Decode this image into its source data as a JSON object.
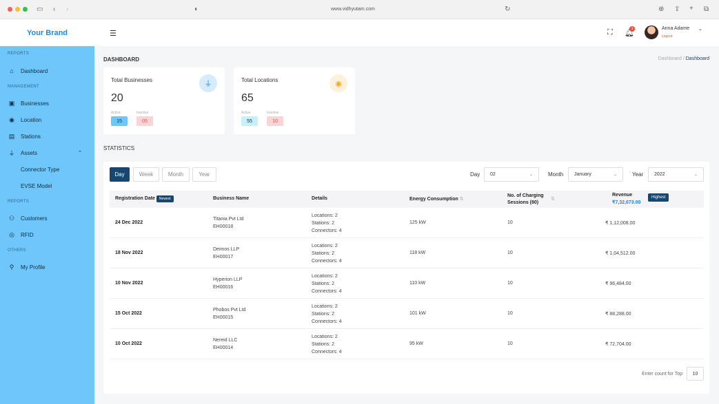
{
  "browser": {
    "url": "www.vidhyutam.com"
  },
  "brand": "Your Brand",
  "sidebar": {
    "sections": {
      "reports1": "REPORTS",
      "management": "MANAGEMENT",
      "reports2": "REPORTS",
      "others": "OTHERS"
    },
    "items": [
      {
        "label": "Dashboard",
        "icon": "home-icon"
      },
      {
        "label": "Businesses",
        "icon": "briefcase-icon"
      },
      {
        "label": "Location",
        "icon": "location-pin-icon"
      },
      {
        "label": "Stations",
        "icon": "building-icon"
      },
      {
        "label": "Assets",
        "icon": "plug-icon"
      },
      {
        "label": "Connector Type",
        "icon": ""
      },
      {
        "label": "EVSE Model",
        "icon": ""
      },
      {
        "label": "Customers",
        "icon": "users-icon"
      },
      {
        "label": "RFID",
        "icon": "rfid-icon"
      },
      {
        "label": "My Profile",
        "icon": "user-icon"
      }
    ]
  },
  "topbar": {
    "notification_count": "3",
    "user_name": "Anna Adame",
    "logout": "Logout"
  },
  "page": {
    "title": "DASHBOARD",
    "breadcrumb_root": "Dashboard",
    "breadcrumb_sep": "/",
    "breadcrumb_current": "Dashboard"
  },
  "cards": [
    {
      "title": "Total Businesses",
      "value": "20",
      "active_label": "Active",
      "active_value": "15",
      "inactive_label": "Inactive",
      "inactive_value": "05",
      "icon": "plug-icon",
      "accent": "#1e88e5"
    },
    {
      "title": "Total Locations",
      "value": "65",
      "active_label": "Active",
      "active_value": "55",
      "inactive_label": "Inactive",
      "inactive_value": "10",
      "icon": "location-pin-icon",
      "accent": "#f5a623"
    }
  ],
  "statistics": {
    "title": "STATISTICS",
    "tabs": [
      "Day",
      "Week",
      "Month",
      "Year"
    ],
    "active_tab": "Day",
    "filters": {
      "day_label": "Day",
      "day_value": "02",
      "month_label": "Month",
      "month_value": "January",
      "year_label": "Year",
      "year_value": "2022"
    },
    "columns": {
      "registration": "Registration Date",
      "newest_badge": "Newest",
      "business": "Business Name",
      "details": "Details",
      "energy": "Energy Consumption",
      "sessions_line1": "No. of Charging",
      "sessions_line2": "Sessions (80)",
      "revenue": "Revenue",
      "revenue_total": "₹7,32,673.00",
      "highest_badge": "Highest"
    },
    "rows": [
      {
        "date": "24 Dec 2022",
        "business": "Titania Pvt Ltd",
        "id": "EH00018",
        "locations": "Locations: 2",
        "stations": "Stations: 2",
        "connectors": "Connectors: 4",
        "energy": "125 kW",
        "sessions": "10",
        "revenue": "₹ 1,12,008.00"
      },
      {
        "date": "18 Nov 2022",
        "business": "Deimos LLP",
        "id": "EH00017",
        "locations": "Locations: 2",
        "stations": "Stations: 2",
        "connectors": "Connectors: 4",
        "energy": "118 kW",
        "sessions": "10",
        "revenue": "₹ 1,04,512.00"
      },
      {
        "date": "10 Nov 2022",
        "business": "Hyperion LLP",
        "id": "EH00016",
        "locations": "Locations: 2",
        "stations": "Stations: 2",
        "connectors": "Connectors: 4",
        "energy": "110 kW",
        "sessions": "10",
        "revenue": "₹ 96,484.00"
      },
      {
        "date": "15 Oct 2022",
        "business": "Phobos Pvt Ltd",
        "id": "EH00015",
        "locations": "Locations: 2",
        "stations": "Stations: 2",
        "connectors": "Connectors: 4",
        "energy": "101 kW",
        "sessions": "10",
        "revenue": "₹ 88,288.00"
      },
      {
        "date": "10 Oct 2022",
        "business": "Nereid LLC",
        "id": "EH00014",
        "locations": "Locations: 2",
        "stations": "Stations: 2",
        "connectors": "Connectors: 4",
        "energy": "95 kW",
        "sessions": "10",
        "revenue": "₹ 72,704.00"
      }
    ],
    "count_label": "Enter count for Top",
    "count_value": "10"
  }
}
